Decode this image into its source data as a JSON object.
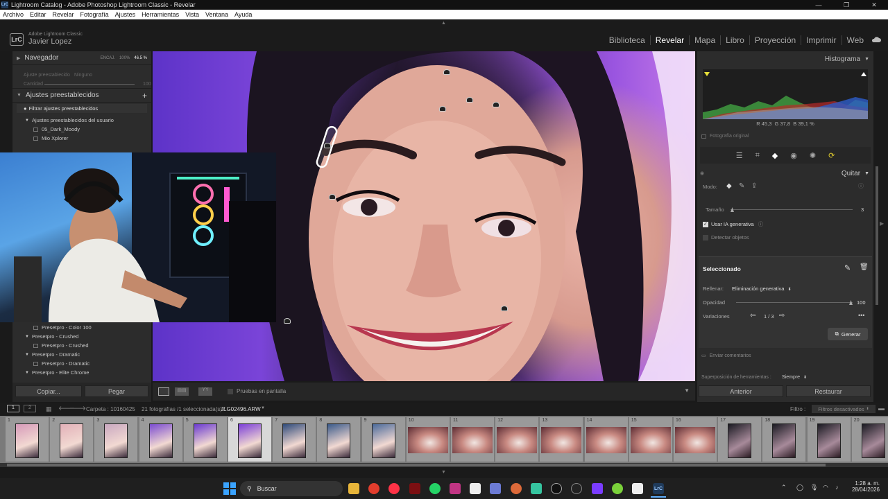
{
  "window": {
    "title": "Lightroom Catalog - Adobe Photoshop Lightroom Classic - Revelar",
    "controls": [
      "—",
      "❐",
      "✕"
    ]
  },
  "menu": [
    "Archivo",
    "Editar",
    "Revelar",
    "Fotografía",
    "Ajustes",
    "Herramientas",
    "Vista",
    "Ventana",
    "Ayuda"
  ],
  "brand": {
    "product": "Adobe Lightroom Classic",
    "user": "Javier Lopez",
    "logo": "LrC"
  },
  "modules": [
    "Biblioteca",
    "Revelar",
    "Mapa",
    "Libro",
    "Proyección",
    "Imprimir",
    "Web"
  ],
  "active_module": "Revelar",
  "left": {
    "navigator": {
      "title": "Navegador",
      "fit": "ENCAJ.",
      "zoom100": "100%",
      "zoom": "46.5 %"
    },
    "preset_amount": {
      "label": "Ajuste preestablecido",
      "value": "Ninguno",
      "amount_label": "Cantidad",
      "amount": "100"
    },
    "presets": {
      "title": "Ajustes preestablecidos",
      "add": "+"
    },
    "filter": "Filtrar ajustes preestablecidos",
    "user_group": "Ajustes preestablecidos del usuario",
    "user_items": [
      "05_Dark_Moody",
      "Mio Xplorer"
    ],
    "lower_items": [
      {
        "type": "item",
        "label": "Presetpro - Color 100"
      },
      {
        "type": "group",
        "label": "Presetpro - Crushed"
      },
      {
        "type": "item",
        "label": "Presetpro - Crushed"
      },
      {
        "type": "group",
        "label": "Presetpro - Dramatic"
      },
      {
        "type": "item",
        "label": "Presetpro - Dramatic"
      },
      {
        "type": "group",
        "label": "Presetpro - Elite Chrome"
      }
    ],
    "copy": "Copiar...",
    "paste": "Pegar"
  },
  "right": {
    "histogram": {
      "title": "Histograma",
      "r_label": "R",
      "r": "45,3",
      "g_label": "G",
      "g": "37,8",
      "b_label": "B",
      "b": "39,1",
      "unit": "%",
      "original": "Fotografía original"
    },
    "panel_title": "Quitar",
    "mode_label": "Modo:",
    "size_label": "Tamaño",
    "size_value": "3",
    "use_ai": "Usar IA generativa",
    "detect": "Detectar objetos",
    "selected": "Seleccionado",
    "fill_label": "Rellenar:",
    "fill_value": "Eliminación generativa",
    "opacity_label": "Opacidad",
    "opacity_value": "100",
    "variations_label": "Variaciones",
    "variations_value": "1 / 3",
    "generate": "Generar",
    "feedback": "Enviar comentarios",
    "overlay_label": "Superposición de herramientas :",
    "overlay_value": "Siempre",
    "previous": "Anterior",
    "reset": "Restaurar"
  },
  "toolbar": {
    "softproof": "Pruebas en pantalla"
  },
  "filmbar": {
    "pages": [
      "1",
      "2"
    ],
    "folder": "Carpeta : 10160425",
    "count": "21 fotografías /1 seleccionada(s) /",
    "file": "JLG02496.ARW",
    "filter_label": "Filtro :",
    "filter_value": "Filtros desactivados"
  },
  "filmstrip": {
    "numbers": [
      "1",
      "2",
      "3",
      "4",
      "5",
      "6",
      "7",
      "8",
      "9",
      "10",
      "11",
      "12",
      "13",
      "14",
      "15",
      "16",
      "17",
      "18",
      "19",
      "20"
    ],
    "selected_index": 5
  },
  "taskbar": {
    "search": "Buscar",
    "time": "1:28 a. m.",
    "date": "28/04/2026"
  },
  "colors": {
    "accent": "#1f6fd1",
    "bg": "#2c2c2c"
  }
}
